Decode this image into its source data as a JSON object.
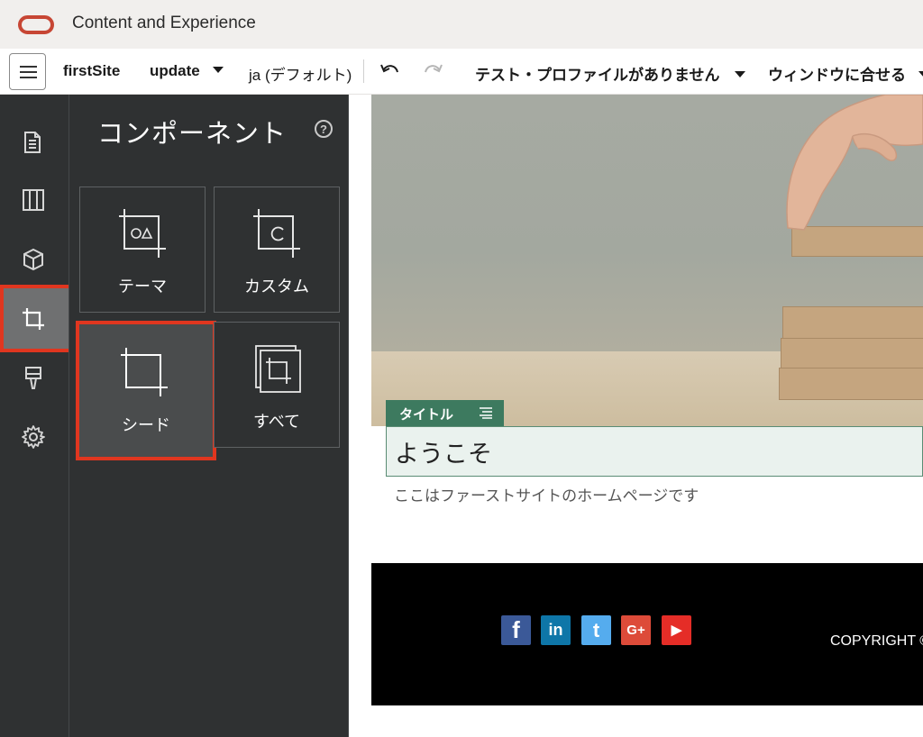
{
  "app": {
    "title": "Content and Experience"
  },
  "toolbar": {
    "site_name": "firstSite",
    "update_label": "update",
    "language_label": "ja (デフォルト)",
    "profile_label": "テスト・プロファイルがありません",
    "fit_label": "ウィンドウに合せる"
  },
  "rail": {
    "items": [
      {
        "icon": "pages-icon"
      },
      {
        "icon": "layout-icon"
      },
      {
        "icon": "cube-icon"
      },
      {
        "icon": "crop-icon",
        "active": true
      },
      {
        "icon": "paint-brush-icon"
      },
      {
        "icon": "gear-icon"
      }
    ]
  },
  "panel": {
    "title": "コンポーネント",
    "help_glyph": "?",
    "tiles": [
      {
        "label": "テーマ",
        "icon": "theme-crop-icon"
      },
      {
        "label": "カスタム",
        "icon": "custom-crop-icon"
      },
      {
        "label": "シード",
        "icon": "seed-crop-icon",
        "selected": true
      },
      {
        "label": "すべて",
        "icon": "all-crop-icon"
      }
    ]
  },
  "canvas": {
    "title_tag": "タイトル",
    "title_text": "ようこそ",
    "subtitle_text": "ここはファーストサイトのホームページです",
    "social": [
      {
        "name": "facebook-icon",
        "glyph": "f",
        "color": "#3b5998"
      },
      {
        "name": "linkedin-icon",
        "glyph": "in",
        "color": "#0e76a8"
      },
      {
        "name": "twitter-icon",
        "glyph": "t",
        "color": "#55acee"
      },
      {
        "name": "google-plus-icon",
        "glyph": "G+",
        "color": "#dd4b39"
      },
      {
        "name": "youtube-icon",
        "glyph": "▶",
        "color": "#e52d27"
      }
    ],
    "copyright": "COPYRIGHT ©"
  },
  "colors": {
    "accent": "#e0361f",
    "oracle_red": "#c74634",
    "title_tag": "#3d7a5f"
  }
}
